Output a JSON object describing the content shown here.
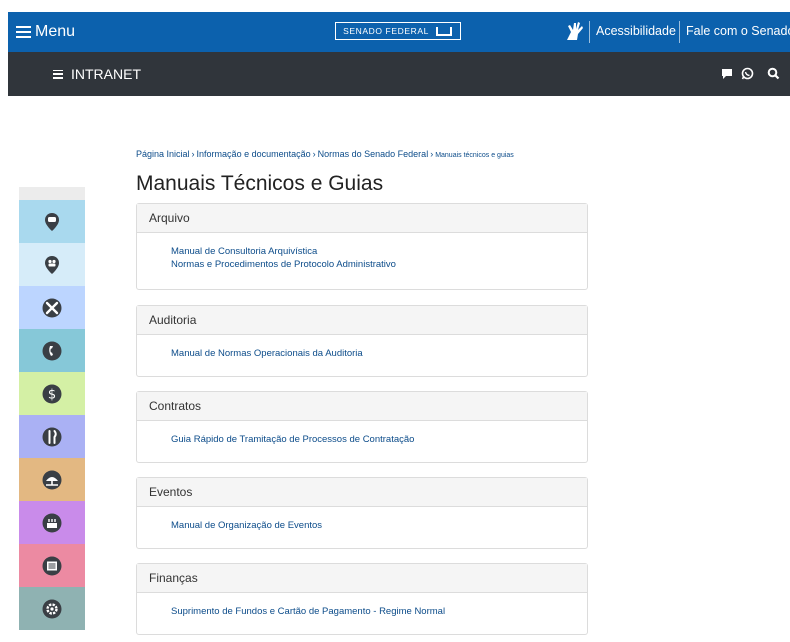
{
  "topbar": {
    "menu_label": "Menu",
    "logo_text": "SENADO FEDERAL",
    "accessibility": "Acessibilidade",
    "contact": "Fale com o Senado"
  },
  "intranet": {
    "label": "INTRANET"
  },
  "breadcrumb": {
    "items": [
      "Página Inicial",
      "Informação e documentação",
      "Normas do Senado Federal"
    ],
    "current": "Manuais técnicos e guias",
    "separator": "›"
  },
  "page_title": "Manuais Técnicos e Guias",
  "sections": [
    {
      "heading": "Arquivo",
      "links": [
        "Manual de Consultoria Arquivística",
        "Normas e Procedimentos de Protocolo Administrativo"
      ]
    },
    {
      "heading": "Auditoria",
      "links": [
        "Manual de Normas Operacionais da Auditoria"
      ]
    },
    {
      "heading": "Contratos",
      "links": [
        "Guia Rápido de Tramitação de Processos de Contratação"
      ]
    },
    {
      "heading": "Eventos",
      "links": [
        "Manual de Organização de Eventos"
      ]
    },
    {
      "heading": "Finanças",
      "links": [
        "Suprimento de Fundos e Cartão de Pagamento - Regime Normal"
      ]
    }
  ],
  "sidebar": [
    {
      "icon": "speech-pin-icon",
      "color": "#a9d9ee"
    },
    {
      "icon": "people-pin-icon",
      "color": "#d6ecf9"
    },
    {
      "icon": "tools-icon",
      "color": "#bcd5ff"
    },
    {
      "icon": "phone-icon",
      "color": "#86c8d8"
    },
    {
      "icon": "dollar-icon",
      "color": "#d4f0a5"
    },
    {
      "icon": "cutlery-icon",
      "color": "#aab1f4"
    },
    {
      "icon": "beach-icon",
      "color": "#e3b882"
    },
    {
      "icon": "cake-icon",
      "color": "#c98bea"
    },
    {
      "icon": "newspaper-icon",
      "color": "#ec8aa2"
    },
    {
      "icon": "gear-icon",
      "color": "#8fb2b2"
    }
  ],
  "colors": {
    "topbar": "#0c61ad",
    "intranet_bar": "#30353b",
    "link": "#0c4c8a"
  }
}
